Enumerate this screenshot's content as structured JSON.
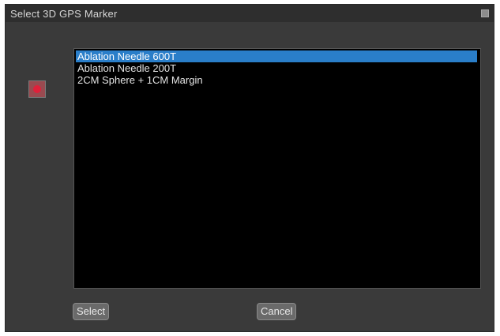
{
  "window": {
    "title": "Select 3D GPS Marker"
  },
  "icons": {
    "marker": "marker-icon",
    "close": "close-icon"
  },
  "list": {
    "items": [
      {
        "label": "Ablation Needle 600T",
        "selected": true
      },
      {
        "label": "Ablation Needle 200T",
        "selected": false
      },
      {
        "label": "2CM Sphere + 1CM Margin",
        "selected": false
      }
    ]
  },
  "buttons": {
    "select_label": "Select",
    "cancel_label": "Cancel"
  },
  "colors": {
    "dialog_bg": "#3a3a3a",
    "list_bg": "#000000",
    "selection": "#2a7ec9",
    "marker": "#e0203a"
  }
}
